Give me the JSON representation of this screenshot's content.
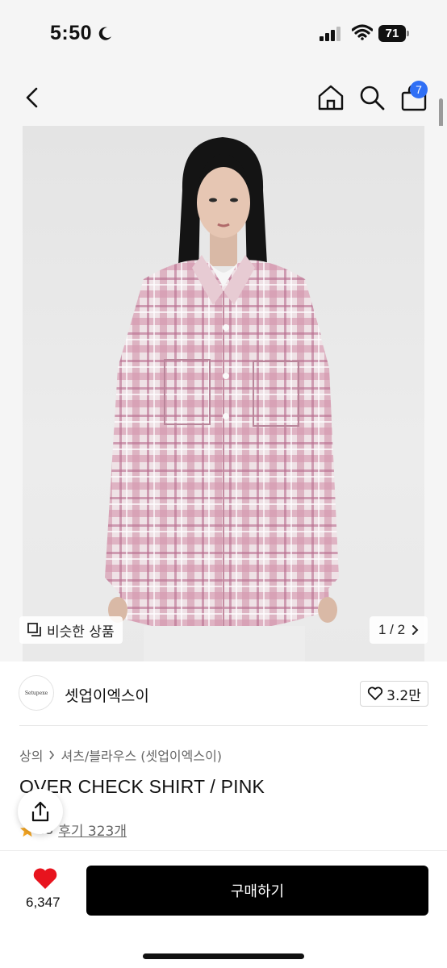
{
  "status_bar": {
    "time": "5:50",
    "battery": "71",
    "icons": [
      "moon-icon",
      "signal-icon",
      "wifi-icon",
      "battery-icon"
    ]
  },
  "header": {
    "icons": [
      "back-icon",
      "home-icon",
      "search-icon",
      "cart-icon"
    ],
    "cart_count": "7",
    "badge_color": "#2f6ff5"
  },
  "gallery": {
    "similar_label": "비슷한 상품",
    "page_current": "1",
    "page_total": "2",
    "page_text": "1 / 2",
    "images": [
      "model wearing pink check shirt"
    ]
  },
  "brand": {
    "logo_text": "Setupexe",
    "name": "셋업이엑스이",
    "likes": "3.2만"
  },
  "product": {
    "breadcrumb": [
      "상의",
      "셔츠/블라우스 (셋업이엑스이)"
    ],
    "title": "OVER CHECK SHIRT / PINK",
    "rating": "4.8",
    "rating_visible": ".8",
    "reviews": "후기 323개",
    "star_color": "#f5a623"
  },
  "bottom_bar": {
    "like_count": "6,347",
    "heart_color": "#e8141e",
    "buy_label": "구매하기"
  }
}
